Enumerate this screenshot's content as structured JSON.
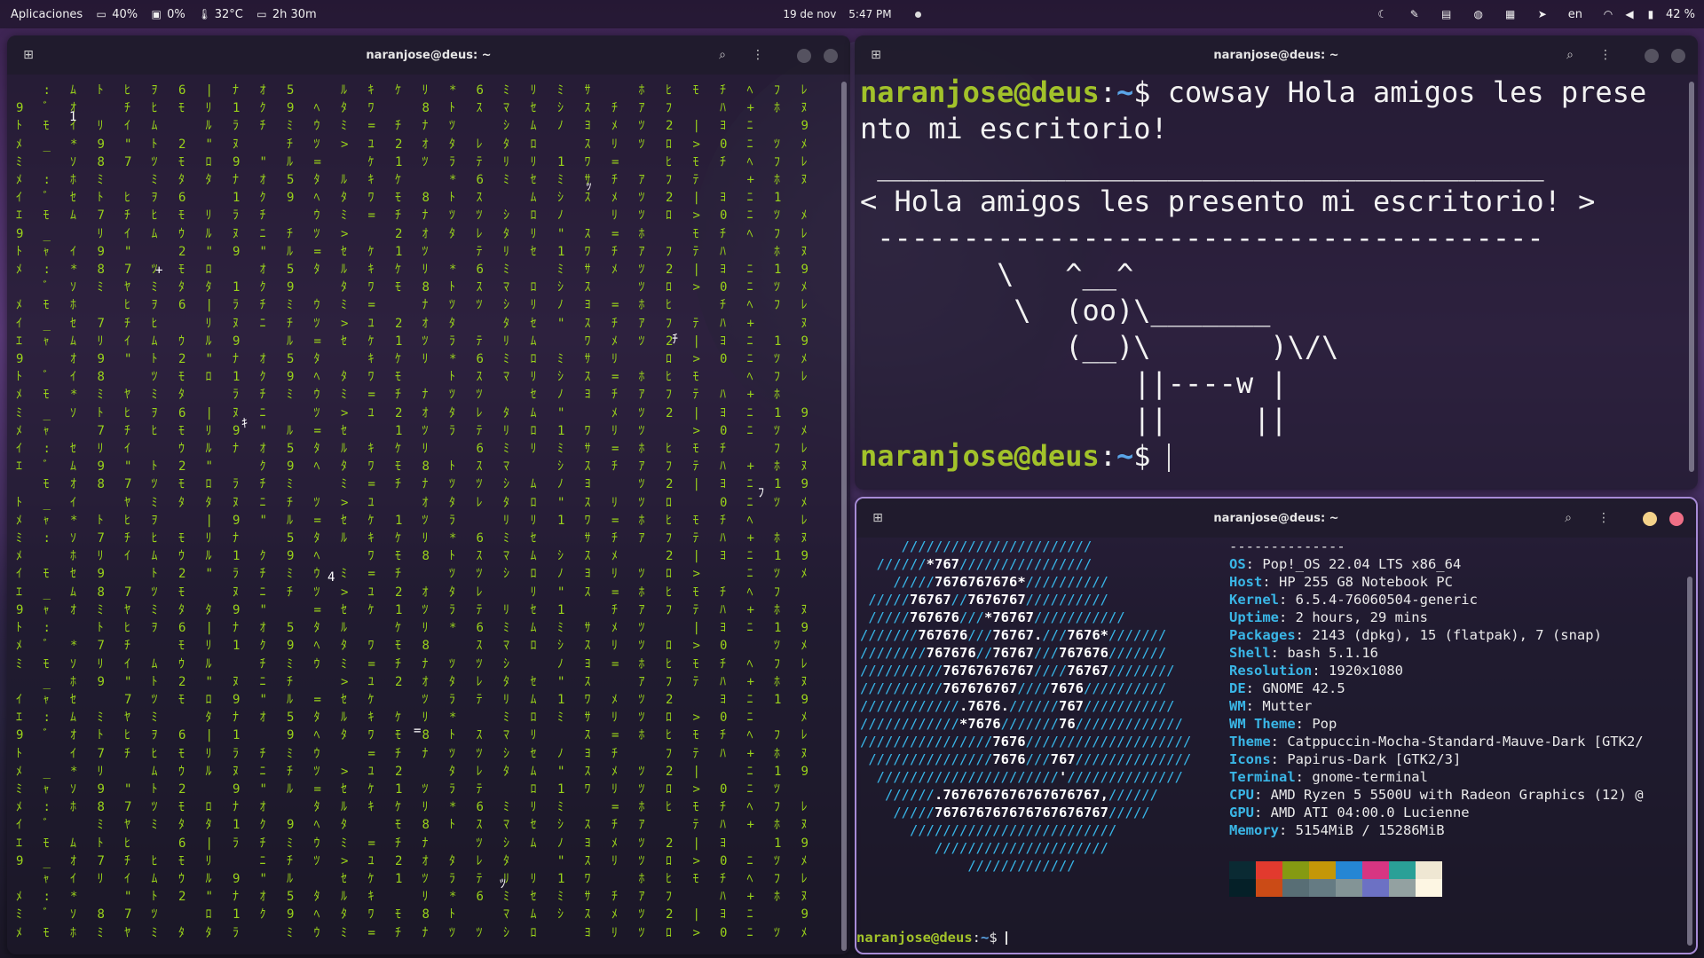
{
  "topbar": {
    "apps_label": "Aplicaciones",
    "battery_stat": "40%",
    "disk_stat": "0%",
    "temp_stat": "32°C",
    "uptime_stat": "2h 30m",
    "date": "19 de nov",
    "time": "5:47 PM",
    "lang": "en",
    "battery_level": "42 %",
    "icons": [
      "moon-icon",
      "color-picker-icon",
      "clipboard-icon",
      "globe-icon",
      "window-tiling-icon",
      "telegram-icon",
      "wifi-icon",
      "volume-icon",
      "battery-icon"
    ]
  },
  "win_matrix": {
    "title": "naranjose@deus: ~",
    "text_color": "#9ad31a",
    "columns": [
      {
        "c": "ｴ9ﾄﾒﾐﾒｲ",
        "w": false
      },
      {
        "c": "ﾓ_ｬ:ﾞ",
        "w": false
      },
      {
        "c": "ｵｲ*ｿﾎｾﾑ",
        "w": false
      },
      {
        "c": "98ﾐﾄ7ﾘ",
        "w": false
      },
      {
        "c": "ﾋﾁｲ\"7ﾔ",
        "w": false
      },
      {
        "c": "ﾄﾂﾐｦﾋﾑ",
        "w": false
      },
      {
        "c": "6ﾓｳ2ﾓﾀ",
        "w": false
      },
      {
        "c": "\"ﾛﾀ|ﾘﾙ",
        "w": false
      },
      {
        "c": "1ﾗﾇ9ﾅ",
        "w": false
      },
      {
        "c": "ﾆ\"ｵｸﾁ",
        "w": false
      },
      {
        "c": "59ﾐﾁﾙ",
        "w": false
      },
      {
        "c": "ｳﾂ=ﾀﾍ",
        "w": false
      },
      {
        "c": "ｾﾙﾀﾐ>",
        "w": false
      },
      {
        "c": "ﾜ=ﾕｹｷ",
        "w": false
      },
      {
        "c": "21ｹﾓﾁ",
        "w": false
      },
      {
        "c": "ﾘ8ﾅｵﾂ",
        "w": false
      },
      {
        "c": "ﾂﾀﾗ*ﾄ",
        "w": false
      },
      {
        "c": "ﾃ6ｽﾂﾚ",
        "w": false
      },
      {
        "c": "ﾏｼﾀﾘﾐ",
        "w": false
      },
      {
        "c": "ﾛﾘｾﾑ",
        "w": false
      },
      {
        "c": "ﾐｼﾉ\"1",
        "w": true
      },
      {
        "c": "ﾖｽﾜｻｽ",
        "w": false
      },
      {
        "c": "ﾒﾘ=ﾁ",
        "w": false
      },
      {
        "c": "ﾂﾎｱﾂ",
        "w": false
      },
      {
        "c": "ﾋﾌ2ﾛ",
        "w": false
      },
      {
        "c": "ﾃ|>ﾓ",
        "w": false
      },
      {
        "c": "ﾖ0ﾁﾊ",
        "w": false
      },
      {
        "c": "ﾆﾍ+ﾆ",
        "w": false
      },
      {
        "c": "ﾌﾎ1ﾂ",
        "w": false
      },
      {
        "c": "ﾇ9ﾒﾚ",
        "w": false
      }
    ],
    "white_glyphs": [
      "1",
      "+",
      "ｷ",
      "4",
      "=",
      "ﾂ",
      "ｯ",
      "ﾁ",
      "ﾌ"
    ]
  },
  "win_cowsay": {
    "title": "naranjose@deus: ~",
    "prompt_user": "naranjose@deus",
    "prompt_sep": ":",
    "prompt_path": "~",
    "prompt_dollar": "$ ",
    "command": "cowsay Hola amigos les prese\nnto mi escritorio!",
    "bubble_top": " _______________________________________",
    "bubble_text": "< Hola amigos les presento mi escritorio! >",
    "bubble_bottom": " ---------------------------------------",
    "cow_lines": [
      "        \\   ^__^",
      "         \\  (oo)\\_______",
      "            (__)\\       )\\/\\",
      "                ||----w |",
      "                ||     ||"
    ]
  },
  "win_neofetch": {
    "title": "naranjose@deus: ~",
    "logo_lines": [
      "     ///////////////////////",
      "  //////*767////////////////",
      "    /////7676767676*//////////",
      " /////76767//7676767//////////",
      " /////767676///*76767///////////",
      "///////767676///76767.///7676*///////",
      "////////767676//76767///767676///////",
      "//////////76767676767////76767////////",
      "//////////767676767////7676//////////",
      "////////////.7676.//////767///////////",
      "////////////*7676///////76/////////////",
      "////////////////7676////////////////////",
      " ///////////////7676///767//////////////",
      "  //////////////////////'//////////////",
      "   //////.7676767676767676767,//////",
      "    /////767676767676767676767/////",
      "      /////////////////////////",
      "         /////////////////////",
      "             /////////////"
    ],
    "separator": "--------------",
    "info": [
      {
        "k": "OS",
        "v": "Pop!_OS 22.04 LTS x86_64"
      },
      {
        "k": "Host",
        "v": "HP 255 G8 Notebook PC"
      },
      {
        "k": "Kernel",
        "v": "6.5.4-76060504-generic"
      },
      {
        "k": "Uptime",
        "v": "2 hours, 29 mins"
      },
      {
        "k": "Packages",
        "v": "2143 (dpkg), 15 (flatpak), 7 (snap)"
      },
      {
        "k": "Shell",
        "v": "bash 5.1.16"
      },
      {
        "k": "Resolution",
        "v": "1920x1080"
      },
      {
        "k": "DE",
        "v": "GNOME 42.5"
      },
      {
        "k": "WM",
        "v": "Mutter"
      },
      {
        "k": "WM Theme",
        "v": "Pop"
      },
      {
        "k": "Theme",
        "v": "Catppuccin-Mocha-Standard-Mauve-Dark [GTK2/"
      },
      {
        "k": "Icons",
        "v": "Papirus-Dark [GTK2/3]"
      },
      {
        "k": "Terminal",
        "v": "gnome-terminal"
      },
      {
        "k": "CPU",
        "v": "AMD Ryzen 5 5500U with Radeon Graphics (12) @"
      },
      {
        "k": "GPU",
        "v": "AMD ATI 04:00.0 Lucienne"
      },
      {
        "k": "Memory",
        "v": "5154MiB / 15286MiB"
      }
    ],
    "palette_top": [
      "#0a2a33",
      "#e23a2e",
      "#859a12",
      "#c49708",
      "#2586d4",
      "#d73582",
      "#2aa097",
      "#efe7d3"
    ],
    "palette_bottom": [
      "#052028",
      "#cb4b16",
      "#586e75",
      "#657b83",
      "#839496",
      "#6c71c4",
      "#93a1a1",
      "#fdf6e3"
    ],
    "prompt_user": "naranjose@deus",
    "prompt_sep": ":",
    "prompt_path": "~",
    "prompt_dollar": "$ "
  }
}
